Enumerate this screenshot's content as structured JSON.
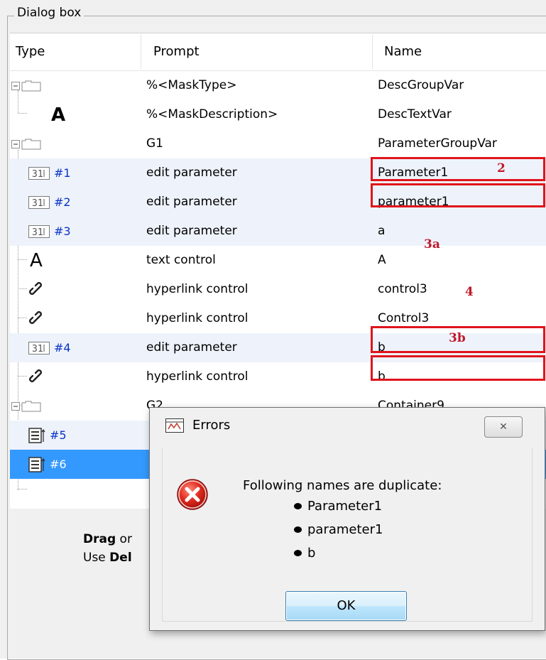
{
  "group_title": "Dialog box",
  "columns": {
    "type": "Type",
    "prompt": "Prompt",
    "name": "Name"
  },
  "rows": [
    {
      "type_icon": "group-container-icon",
      "num": "",
      "prompt": "%<MaskType>",
      "name": "DescGroupVar"
    },
    {
      "type_icon": "text-a-icon",
      "num": "",
      "prompt": "%<MaskDescription>",
      "name": "DescTextVar"
    },
    {
      "type_icon": "group-container-icon",
      "num": "",
      "prompt": "G1",
      "name": "ParameterGroupVar"
    },
    {
      "type_icon": "edit-parameter-icon",
      "num": "#1",
      "prompt": "edit parameter",
      "name": "Parameter1"
    },
    {
      "type_icon": "edit-parameter-icon",
      "num": "#2",
      "prompt": "edit parameter",
      "name": "parameter1"
    },
    {
      "type_icon": "edit-parameter-icon",
      "num": "#3",
      "prompt": "edit parameter",
      "name": "a"
    },
    {
      "type_icon": "text-a-icon",
      "num": "",
      "prompt": "text control",
      "name": "A"
    },
    {
      "type_icon": "hyperlink-icon",
      "num": "",
      "prompt": "hyperlink control",
      "name": "control3"
    },
    {
      "type_icon": "hyperlink-icon",
      "num": "",
      "prompt": "hyperlink control",
      "name": "Control3"
    },
    {
      "type_icon": "edit-parameter-icon",
      "num": "#4",
      "prompt": "edit parameter",
      "name": "b"
    },
    {
      "type_icon": "hyperlink-icon",
      "num": "",
      "prompt": "hyperlink control",
      "name": "b"
    },
    {
      "type_icon": "group-container-icon",
      "num": "",
      "prompt": "G2",
      "name": "Container9"
    },
    {
      "type_icon": "popup-parameter-icon",
      "num": "#5",
      "prompt": "",
      "name": ""
    },
    {
      "type_icon": "popup-parameter-icon",
      "num": "#6",
      "prompt": "",
      "name": ""
    }
  ],
  "annotations": [
    "2",
    "3a",
    "4",
    "3b"
  ],
  "hint": {
    "drag_bold": "Drag",
    "drag_rest": " or",
    "use_pre": "Use ",
    "use_bold": "Del"
  },
  "error_dialog": {
    "title": "Errors",
    "close_glyph": "✕",
    "message": "Following names are duplicate:",
    "duplicates": [
      "Parameter1",
      "parameter1",
      "b"
    ],
    "ok_label": "OK"
  },
  "colors": {
    "selection": "#3399ff",
    "alt_row": "#eef3fb",
    "highlight_box": "#e0151b",
    "annotation": "#c0182a",
    "index_number": "#0a33c8"
  }
}
